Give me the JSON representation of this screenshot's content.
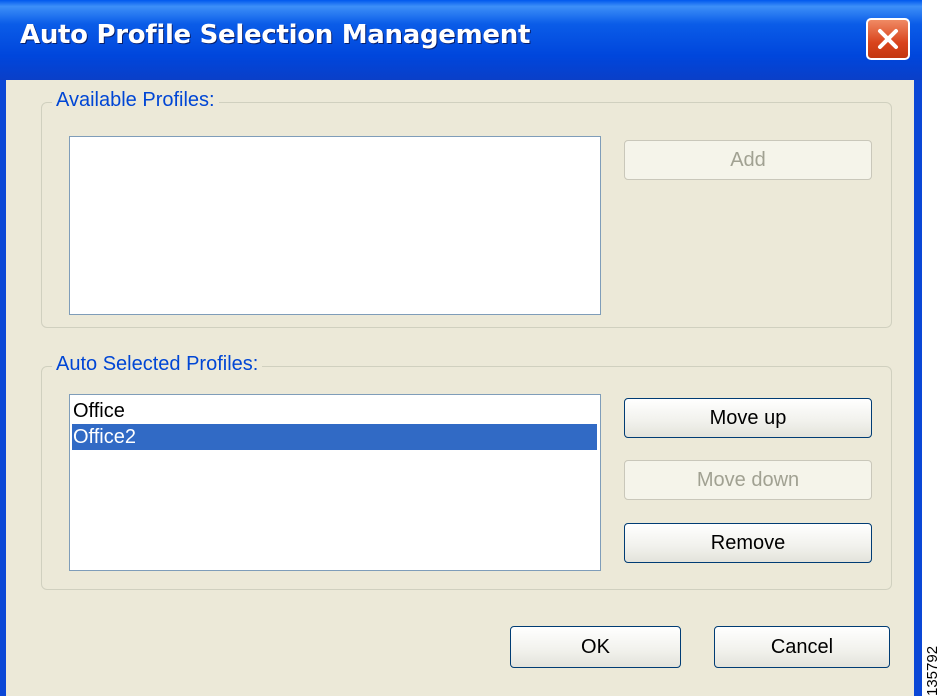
{
  "window": {
    "title": "Auto Profile Selection Management",
    "close_icon": "close-icon"
  },
  "available_profiles": {
    "label": "Available Profiles:",
    "items": [],
    "add_label": "Add"
  },
  "auto_selected_profiles": {
    "label": "Auto Selected Profiles:",
    "items": [
      "Office",
      "Office2"
    ],
    "selected_item": "Office2",
    "move_up_label": "Move up",
    "move_down_label": "Move down",
    "remove_label": "Remove"
  },
  "footer": {
    "ok_label": "OK",
    "cancel_label": "Cancel"
  },
  "figure_id": "135792",
  "colors": {
    "title_bar": "#0058ee",
    "client": "#ece9d8",
    "group_label": "#0046d5",
    "selection": "#316ac5",
    "close_button": "#d9441c"
  }
}
